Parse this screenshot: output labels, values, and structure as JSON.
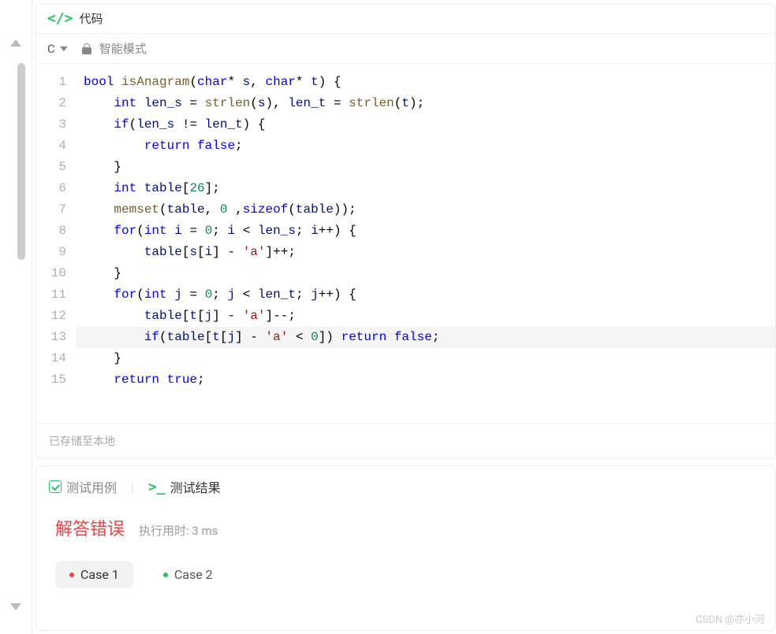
{
  "header": {
    "title": "代码"
  },
  "toolbar": {
    "language": "C",
    "mode": "智能模式"
  },
  "editor": {
    "highlighted_line": 13,
    "lines": [
      {
        "n": 1,
        "tokens": [
          [
            "ty",
            "bool"
          ],
          [
            "sp",
            " "
          ],
          [
            "fn",
            "isAnagram"
          ],
          [
            "pn",
            "("
          ],
          [
            "ty",
            "char"
          ],
          [
            "op",
            "*"
          ],
          [
            "sp",
            " "
          ],
          [
            "id",
            "s"
          ],
          [
            "pn",
            ","
          ],
          [
            "sp",
            " "
          ],
          [
            "ty",
            "char"
          ],
          [
            "op",
            "*"
          ],
          [
            "sp",
            " "
          ],
          [
            "id",
            "t"
          ],
          [
            "pn",
            ")"
          ],
          [
            "sp",
            " "
          ],
          [
            "pn",
            "{"
          ]
        ]
      },
      {
        "n": 2,
        "indent": 1,
        "tokens": [
          [
            "ty",
            "int"
          ],
          [
            "sp",
            " "
          ],
          [
            "id",
            "len_s"
          ],
          [
            "sp",
            " "
          ],
          [
            "op",
            "="
          ],
          [
            "sp",
            " "
          ],
          [
            "fn",
            "strlen"
          ],
          [
            "pn",
            "("
          ],
          [
            "id",
            "s"
          ],
          [
            "pn",
            ")"
          ],
          [
            "pn",
            ","
          ],
          [
            "sp",
            " "
          ],
          [
            "id",
            "len_t"
          ],
          [
            "sp",
            " "
          ],
          [
            "op",
            "="
          ],
          [
            "sp",
            " "
          ],
          [
            "fn",
            "strlen"
          ],
          [
            "pn",
            "("
          ],
          [
            "id",
            "t"
          ],
          [
            "pn",
            ")"
          ],
          [
            "pn",
            ";"
          ]
        ]
      },
      {
        "n": 3,
        "indent": 1,
        "tokens": [
          [
            "kw",
            "if"
          ],
          [
            "pn",
            "("
          ],
          [
            "id",
            "len_s"
          ],
          [
            "sp",
            " "
          ],
          [
            "op",
            "!="
          ],
          [
            "sp",
            " "
          ],
          [
            "id",
            "len_t"
          ],
          [
            "pn",
            ")"
          ],
          [
            "sp",
            " "
          ],
          [
            "pn",
            "{"
          ]
        ]
      },
      {
        "n": 4,
        "indent": 2,
        "tokens": [
          [
            "kw",
            "return"
          ],
          [
            "sp",
            " "
          ],
          [
            "bl",
            "false"
          ],
          [
            "pn",
            ";"
          ]
        ]
      },
      {
        "n": 5,
        "indent": 1,
        "tokens": [
          [
            "pn",
            "}"
          ]
        ]
      },
      {
        "n": 6,
        "indent": 1,
        "tokens": [
          [
            "ty",
            "int"
          ],
          [
            "sp",
            " "
          ],
          [
            "id",
            "table"
          ],
          [
            "pn",
            "["
          ],
          [
            "nm",
            "26"
          ],
          [
            "pn",
            "]"
          ],
          [
            "pn",
            ";"
          ]
        ]
      },
      {
        "n": 7,
        "indent": 1,
        "tokens": [
          [
            "fn",
            "memset"
          ],
          [
            "pn",
            "("
          ],
          [
            "id",
            "table"
          ],
          [
            "pn",
            ","
          ],
          [
            "sp",
            " "
          ],
          [
            "nm",
            "0"
          ],
          [
            "sp",
            " "
          ],
          [
            "pn",
            ","
          ],
          [
            "kw",
            "sizeof"
          ],
          [
            "pn",
            "("
          ],
          [
            "id",
            "table"
          ],
          [
            "pn",
            ")"
          ],
          [
            "pn",
            ")"
          ],
          [
            "pn",
            ";"
          ]
        ]
      },
      {
        "n": 8,
        "indent": 1,
        "tokens": [
          [
            "kw",
            "for"
          ],
          [
            "pn",
            "("
          ],
          [
            "ty",
            "int"
          ],
          [
            "sp",
            " "
          ],
          [
            "id",
            "i"
          ],
          [
            "sp",
            " "
          ],
          [
            "op",
            "="
          ],
          [
            "sp",
            " "
          ],
          [
            "nm",
            "0"
          ],
          [
            "pn",
            ";"
          ],
          [
            "sp",
            " "
          ],
          [
            "id",
            "i"
          ],
          [
            "sp",
            " "
          ],
          [
            "op",
            "<"
          ],
          [
            "sp",
            " "
          ],
          [
            "id",
            "len_s"
          ],
          [
            "pn",
            ";"
          ],
          [
            "sp",
            " "
          ],
          [
            "id",
            "i"
          ],
          [
            "op",
            "++"
          ],
          [
            "pn",
            ")"
          ],
          [
            "sp",
            " "
          ],
          [
            "pn",
            "{"
          ]
        ]
      },
      {
        "n": 9,
        "indent": 2,
        "tokens": [
          [
            "id",
            "table"
          ],
          [
            "pn",
            "["
          ],
          [
            "id",
            "s"
          ],
          [
            "pn",
            "["
          ],
          [
            "id",
            "i"
          ],
          [
            "pn",
            "]"
          ],
          [
            "sp",
            " "
          ],
          [
            "op",
            "-"
          ],
          [
            "sp",
            " "
          ],
          [
            "st",
            "'a'"
          ],
          [
            "pn",
            "]"
          ],
          [
            "op",
            "++"
          ],
          [
            "pn",
            ";"
          ]
        ]
      },
      {
        "n": 10,
        "indent": 1,
        "tokens": [
          [
            "pn",
            "}"
          ]
        ]
      },
      {
        "n": 11,
        "indent": 1,
        "tokens": [
          [
            "kw",
            "for"
          ],
          [
            "pn",
            "("
          ],
          [
            "ty",
            "int"
          ],
          [
            "sp",
            " "
          ],
          [
            "id",
            "j"
          ],
          [
            "sp",
            " "
          ],
          [
            "op",
            "="
          ],
          [
            "sp",
            " "
          ],
          [
            "nm",
            "0"
          ],
          [
            "pn",
            ";"
          ],
          [
            "sp",
            " "
          ],
          [
            "id",
            "j"
          ],
          [
            "sp",
            " "
          ],
          [
            "op",
            "<"
          ],
          [
            "sp",
            " "
          ],
          [
            "id",
            "len_t"
          ],
          [
            "pn",
            ";"
          ],
          [
            "sp",
            " "
          ],
          [
            "id",
            "j"
          ],
          [
            "op",
            "++"
          ],
          [
            "pn",
            ")"
          ],
          [
            "sp",
            " "
          ],
          [
            "pn",
            "{"
          ]
        ]
      },
      {
        "n": 12,
        "indent": 2,
        "tokens": [
          [
            "id",
            "table"
          ],
          [
            "pn",
            "["
          ],
          [
            "id",
            "t"
          ],
          [
            "pn",
            "["
          ],
          [
            "id",
            "j"
          ],
          [
            "pn",
            "]"
          ],
          [
            "sp",
            " "
          ],
          [
            "op",
            "-"
          ],
          [
            "sp",
            " "
          ],
          [
            "st",
            "'a'"
          ],
          [
            "pn",
            "]"
          ],
          [
            "op",
            "--"
          ],
          [
            "pn",
            ";"
          ]
        ]
      },
      {
        "n": 13,
        "indent": 2,
        "tokens": [
          [
            "kw",
            "if"
          ],
          [
            "pn",
            "("
          ],
          [
            "id",
            "table"
          ],
          [
            "pn",
            "["
          ],
          [
            "id",
            "t"
          ],
          [
            "pn",
            "["
          ],
          [
            "id",
            "j"
          ],
          [
            "pn",
            "]"
          ],
          [
            "sp",
            " "
          ],
          [
            "op",
            "-"
          ],
          [
            "sp",
            " "
          ],
          [
            "st",
            "'a'"
          ],
          [
            "sp",
            " "
          ],
          [
            "op",
            "<"
          ],
          [
            "sp",
            " "
          ],
          [
            "nm",
            "0"
          ],
          [
            "pn",
            "]"
          ],
          [
            "pn",
            ")"
          ],
          [
            "sp",
            " "
          ],
          [
            "kw",
            "return"
          ],
          [
            "sp",
            " "
          ],
          [
            "bl",
            "false"
          ],
          [
            "pn",
            ";"
          ]
        ]
      },
      {
        "n": 14,
        "indent": 1,
        "tokens": [
          [
            "pn",
            "}"
          ]
        ]
      },
      {
        "n": 15,
        "indent": 1,
        "tokens": [
          [
            "kw",
            "return"
          ],
          [
            "sp",
            " "
          ],
          [
            "bl",
            "true"
          ],
          [
            "pn",
            ";"
          ]
        ]
      }
    ]
  },
  "status": {
    "saved": "已存储至本地"
  },
  "results": {
    "tab_testcase": "测试用例",
    "tab_result": "测试结果",
    "status_text": "解答错误",
    "runtime_label": "执行用时: 3 ms",
    "cases": [
      {
        "label": "Case 1",
        "status": "fail"
      },
      {
        "label": "Case 2",
        "status": "pass"
      }
    ]
  },
  "watermark": "CSDN @亦小河"
}
